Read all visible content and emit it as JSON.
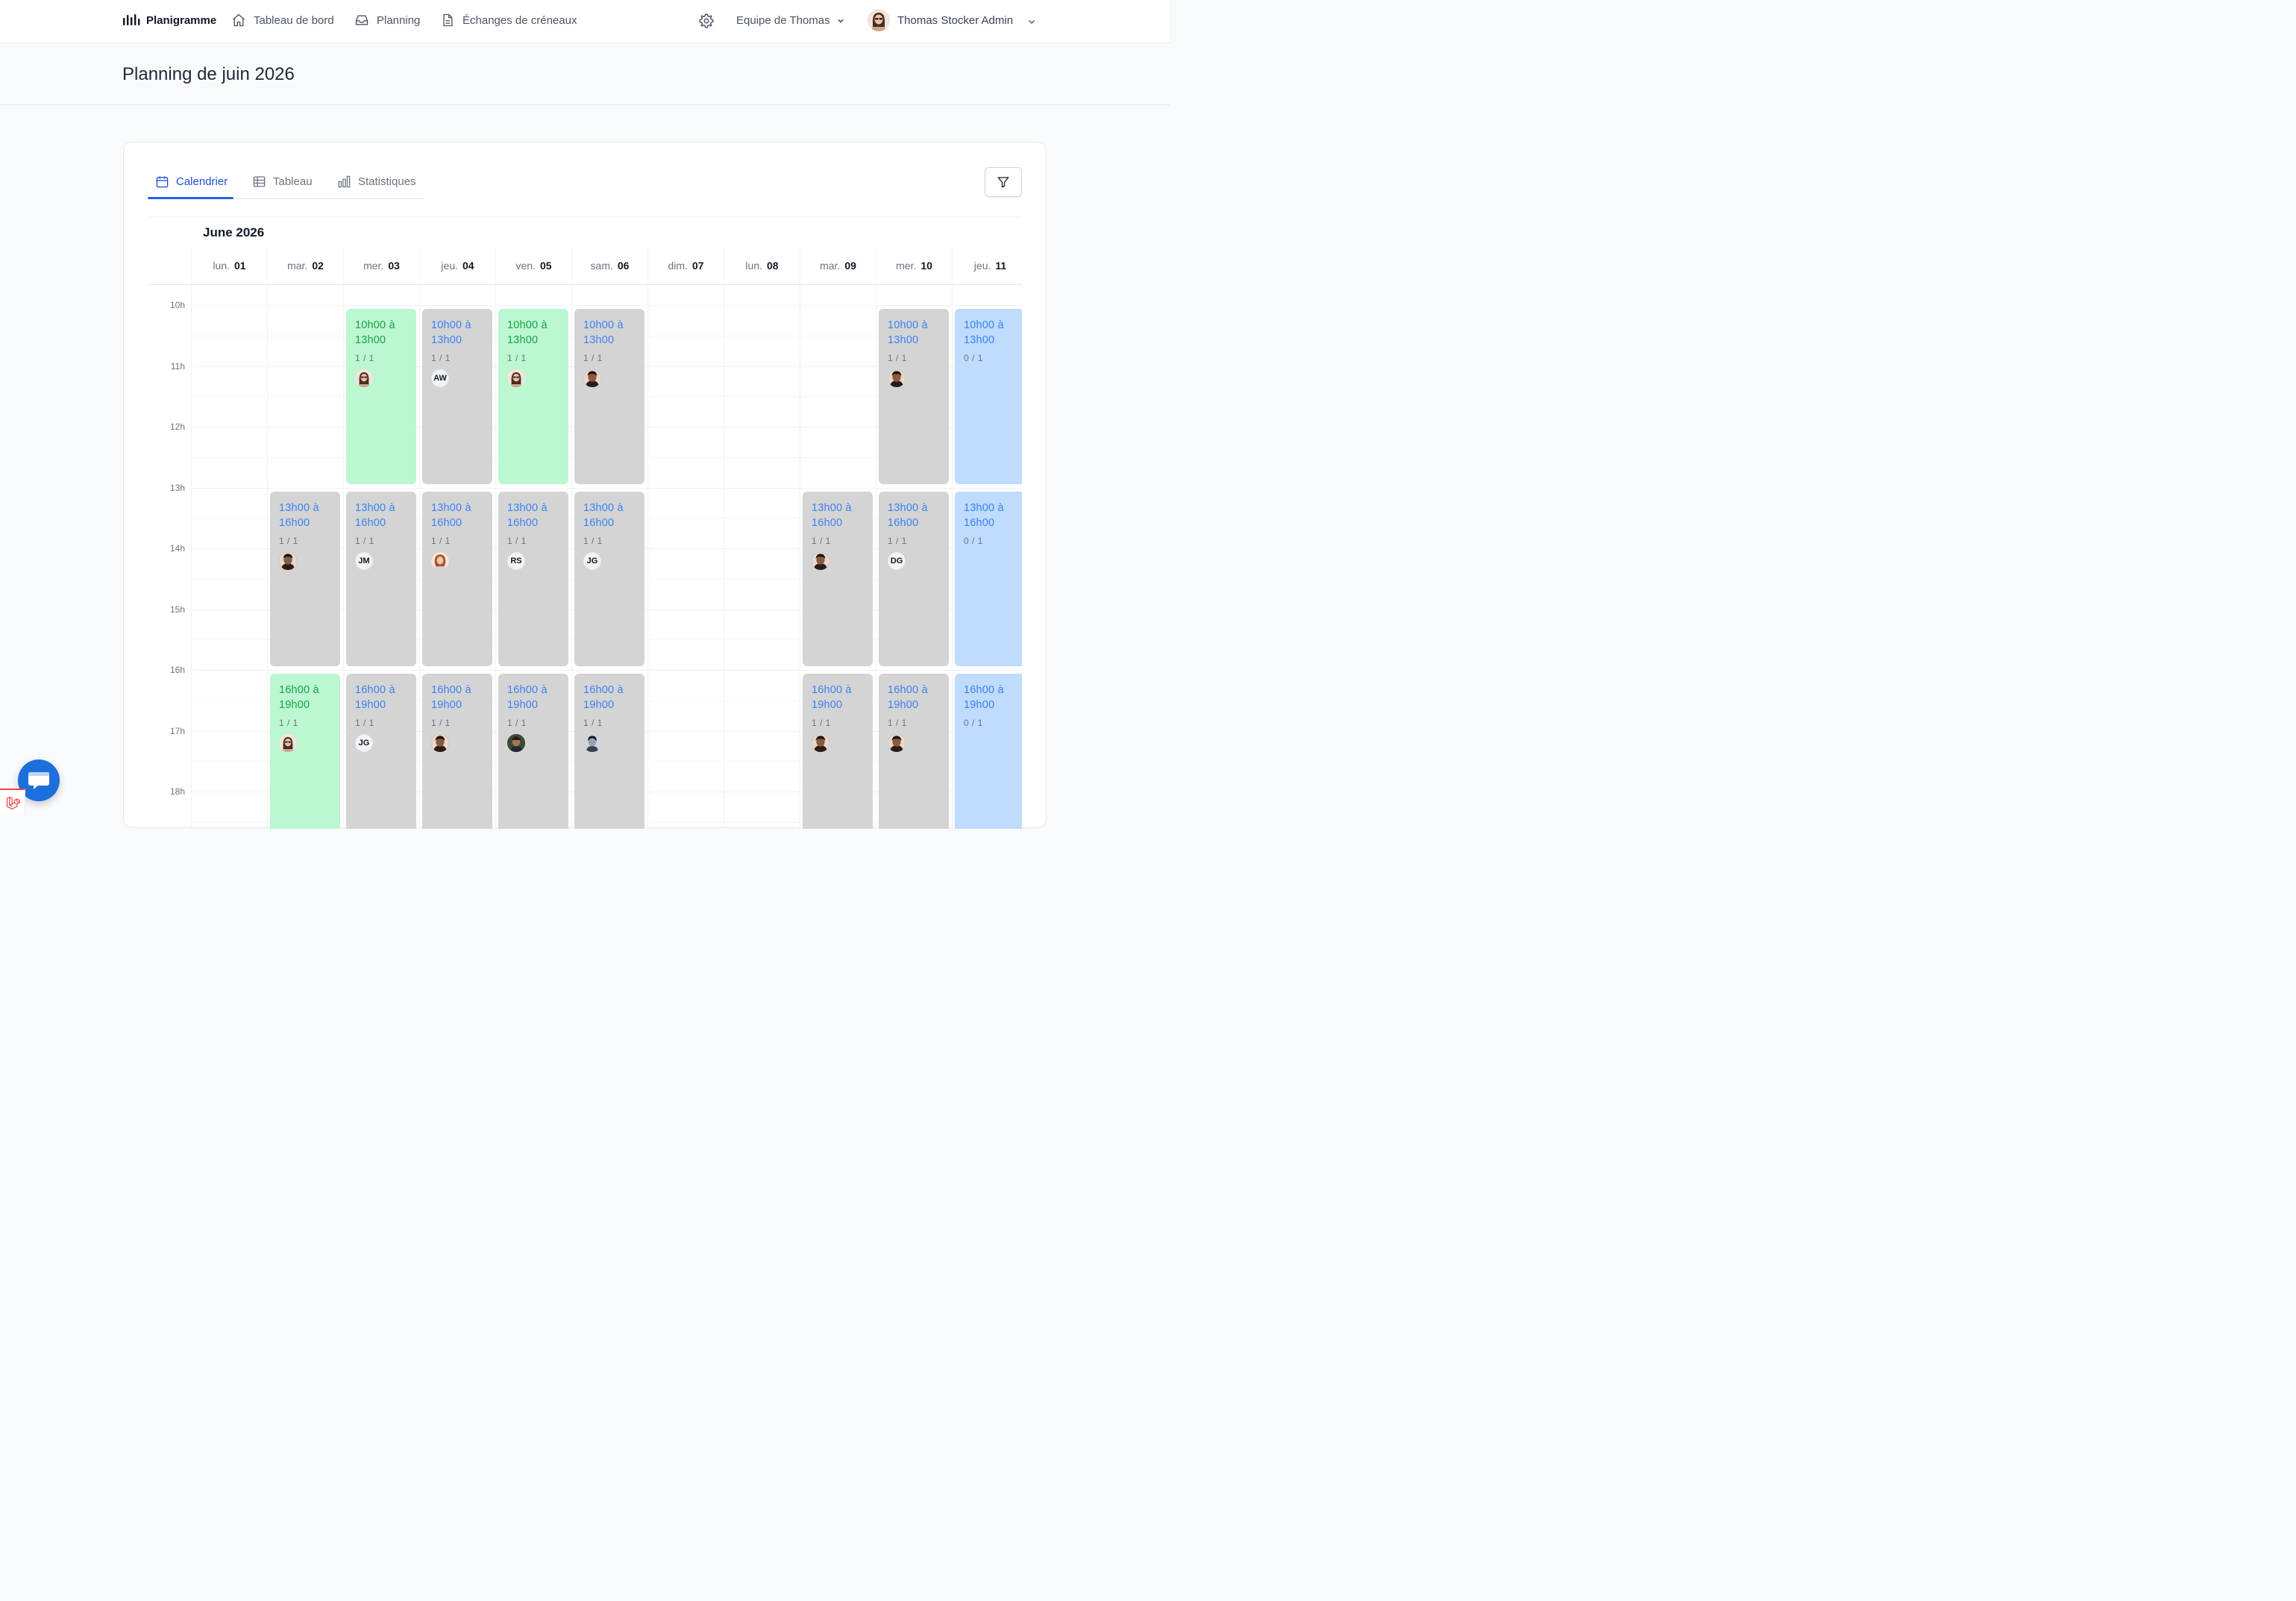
{
  "nav": {
    "brand": "Planigramme",
    "links": [
      {
        "label": "Tableau de bord",
        "icon": "home-icon"
      },
      {
        "label": "Planning",
        "icon": "inbox-icon"
      },
      {
        "label": "Échanges de créneaux",
        "icon": "document-icon"
      }
    ],
    "team_label": "Equipe de Thomas",
    "user_name": "Thomas Stocker Admin"
  },
  "page": {
    "title": "Planning de juin 2026"
  },
  "tabs": [
    {
      "label": "Calendrier",
      "icon": "calendar-icon",
      "active": true
    },
    {
      "label": "Tableau",
      "icon": "table-icon",
      "active": false
    },
    {
      "label": "Statistiques",
      "icon": "bar-chart-icon",
      "active": false
    }
  ],
  "calendar": {
    "month_label": "June 2026",
    "days": [
      {
        "name": "lun.",
        "num": "01"
      },
      {
        "name": "mar.",
        "num": "02"
      },
      {
        "name": "mer.",
        "num": "03"
      },
      {
        "name": "jeu.",
        "num": "04"
      },
      {
        "name": "ven.",
        "num": "05"
      },
      {
        "name": "sam.",
        "num": "06"
      },
      {
        "name": "dim.",
        "num": "07"
      },
      {
        "name": "lun.",
        "num": "08"
      },
      {
        "name": "mar.",
        "num": "09"
      },
      {
        "name": "mer.",
        "num": "10"
      },
      {
        "name": "jeu.",
        "num": "11"
      }
    ],
    "hours": [
      "10h",
      "11h",
      "12h",
      "13h",
      "14h",
      "15h",
      "16h",
      "17h",
      "18h"
    ],
    "shifts": [
      {
        "day": 2,
        "start": 10,
        "end": 13,
        "time_line1": "10h00 à",
        "time_line2": "13h00",
        "count": "1 / 1",
        "color": "green",
        "who": {
          "type": "photo-f"
        }
      },
      {
        "day": 3,
        "start": 10,
        "end": 13,
        "time_line1": "10h00 à",
        "time_line2": "13h00",
        "count": "1 / 1",
        "color": "grey",
        "who": {
          "type": "initials",
          "text": "AW"
        }
      },
      {
        "day": 4,
        "start": 10,
        "end": 13,
        "time_line1": "10h00 à",
        "time_line2": "13h00",
        "count": "1 / 1",
        "color": "green",
        "who": {
          "type": "photo-f"
        }
      },
      {
        "day": 5,
        "start": 10,
        "end": 13,
        "time_line1": "10h00 à",
        "time_line2": "13h00",
        "count": "1 / 1",
        "color": "grey",
        "who": {
          "type": "photo-m"
        }
      },
      {
        "day": 9,
        "start": 10,
        "end": 13,
        "time_line1": "10h00 à",
        "time_line2": "13h00",
        "count": "1 / 1",
        "color": "grey",
        "who": {
          "type": "photo-m"
        }
      },
      {
        "day": 10,
        "start": 10,
        "end": 13,
        "time_line1": "10h00 à",
        "time_line2": "13h00",
        "count": "0 / 1",
        "color": "blue",
        "who": null
      },
      {
        "day": 1,
        "start": 13,
        "end": 16,
        "time_line1": "13h00 à",
        "time_line2": "16h00",
        "count": "1 / 1",
        "color": "grey",
        "who": {
          "type": "photo-m"
        }
      },
      {
        "day": 2,
        "start": 13,
        "end": 16,
        "time_line1": "13h00 à",
        "time_line2": "16h00",
        "count": "1 / 1",
        "color": "grey",
        "who": {
          "type": "initials",
          "text": "JM"
        }
      },
      {
        "day": 3,
        "start": 13,
        "end": 16,
        "time_line1": "13h00 à",
        "time_line2": "16h00",
        "count": "1 / 1",
        "color": "grey",
        "who": {
          "type": "photo-f2"
        }
      },
      {
        "day": 4,
        "start": 13,
        "end": 16,
        "time_line1": "13h00 à",
        "time_line2": "16h00",
        "count": "1 / 1",
        "color": "grey",
        "who": {
          "type": "initials",
          "text": "RS"
        }
      },
      {
        "day": 5,
        "start": 13,
        "end": 16,
        "time_line1": "13h00 à",
        "time_line2": "16h00",
        "count": "1 / 1",
        "color": "grey",
        "who": {
          "type": "initials",
          "text": "JG"
        }
      },
      {
        "day": 8,
        "start": 13,
        "end": 16,
        "time_line1": "13h00 à",
        "time_line2": "16h00",
        "count": "1 / 1",
        "color": "grey",
        "who": {
          "type": "photo-m"
        }
      },
      {
        "day": 9,
        "start": 13,
        "end": 16,
        "time_line1": "13h00 à",
        "time_line2": "16h00",
        "count": "1 / 1",
        "color": "grey",
        "who": {
          "type": "initials",
          "text": "DG"
        }
      },
      {
        "day": 10,
        "start": 13,
        "end": 16,
        "time_line1": "13h00 à",
        "time_line2": "16h00",
        "count": "0 / 1",
        "color": "blue",
        "who": null
      },
      {
        "day": 1,
        "start": 16,
        "end": 19,
        "time_line1": "16h00 à",
        "time_line2": "19h00",
        "count": "1 / 1",
        "color": "green",
        "who": {
          "type": "photo-f"
        }
      },
      {
        "day": 2,
        "start": 16,
        "end": 19,
        "time_line1": "16h00 à",
        "time_line2": "19h00",
        "count": "1 / 1",
        "color": "grey",
        "who": {
          "type": "initials",
          "text": "JG"
        }
      },
      {
        "day": 3,
        "start": 16,
        "end": 19,
        "time_line1": "16h00 à",
        "time_line2": "19h00",
        "count": "1 / 1",
        "color": "grey",
        "who": {
          "type": "photo-m"
        }
      },
      {
        "day": 4,
        "start": 16,
        "end": 19,
        "time_line1": "16h00 à",
        "time_line2": "19h00",
        "count": "1 / 1",
        "color": "grey",
        "who": {
          "type": "photo-m2"
        }
      },
      {
        "day": 5,
        "start": 16,
        "end": 19,
        "time_line1": "16h00 à",
        "time_line2": "19h00",
        "count": "1 / 1",
        "color": "grey",
        "who": {
          "type": "photo-g"
        }
      },
      {
        "day": 8,
        "start": 16,
        "end": 19,
        "time_line1": "16h00 à",
        "time_line2": "19h00",
        "count": "1 / 1",
        "color": "grey",
        "who": {
          "type": "photo-m"
        }
      },
      {
        "day": 9,
        "start": 16,
        "end": 19,
        "time_line1": "16h00 à",
        "time_line2": "19h00",
        "count": "1 / 1",
        "color": "grey",
        "who": {
          "type": "photo-m"
        }
      },
      {
        "day": 10,
        "start": 16,
        "end": 19,
        "time_line1": "16h00 à",
        "time_line2": "19h00",
        "count": "0 / 1",
        "color": "blue",
        "who": null
      }
    ]
  },
  "colors": {
    "accent": "#2563eb",
    "shift_green": "#bbf7d0",
    "shift_grey": "#d4d4d4",
    "shift_blue": "#bfdbfe",
    "chat_button": "#1d6fdc"
  }
}
